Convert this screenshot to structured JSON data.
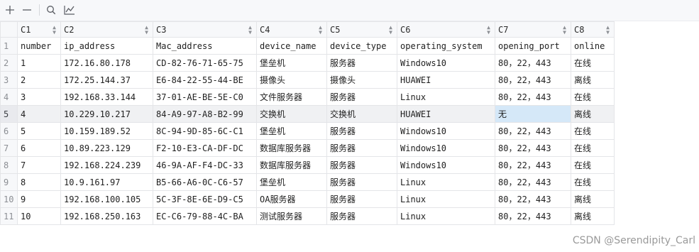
{
  "toolbar": {
    "add_icon": "plus-icon",
    "remove_icon": "minus-icon",
    "search_icon": "search-icon",
    "chart_icon": "line-chart-icon"
  },
  "columns": [
    "C1",
    "C2",
    "C3",
    "C4",
    "C5",
    "C6",
    "C7",
    "C8"
  ],
  "rows": [
    {
      "n": "1",
      "cells": [
        "number",
        "ip_address",
        "Mac_address",
        "device_name",
        "device_type",
        "operating_system",
        "opening_port",
        "online"
      ]
    },
    {
      "n": "2",
      "cells": [
        "1",
        "172.16.80.178",
        "CD-82-76-71-65-75",
        "堡垒机",
        "服务器",
        "Windows10",
        "80，22，443",
        "在线"
      ]
    },
    {
      "n": "3",
      "cells": [
        "2",
        "172.25.144.37",
        "E6-84-22-55-44-BE",
        "摄像头",
        "摄像头",
        "HUAWEI",
        "80，22，443",
        "离线"
      ]
    },
    {
      "n": "4",
      "cells": [
        "3",
        "192.168.33.144",
        "37-01-AE-BE-5E-C0",
        "文件服务器",
        "服务器",
        "Linux",
        "80，22，443",
        "在线"
      ]
    },
    {
      "n": "5",
      "cells": [
        "4",
        "10.229.10.217",
        "84-A9-97-A8-B2-99",
        "交换机",
        "交换机",
        "HUAWEI",
        "无",
        "离线"
      ]
    },
    {
      "n": "6",
      "cells": [
        "5",
        "10.159.189.52",
        "8C-94-9D-85-6C-C1",
        "堡垒机",
        "服务器",
        "Windows10",
        "80，22，443",
        "在线"
      ]
    },
    {
      "n": "7",
      "cells": [
        "6",
        "10.89.223.129",
        "F2-10-E3-CA-DF-DC",
        "数据库服务器",
        "服务器",
        "Windows10",
        "80，22，443",
        "在线"
      ]
    },
    {
      "n": "8",
      "cells": [
        "7",
        "192.168.224.239",
        "46-9A-AF-F4-DC-33",
        "数据库服务器",
        "服务器",
        "Windows10",
        "80，22，443",
        "在线"
      ]
    },
    {
      "n": "9",
      "cells": [
        "8",
        "10.9.161.97",
        "B5-66-A6-0C-C6-57",
        "堡垒机",
        "服务器",
        "Linux",
        "80，22，443",
        "在线"
      ]
    },
    {
      "n": "10",
      "cells": [
        "9",
        "192.168.100.105",
        "5C-3F-8E-6E-D9-C5",
        "OA服务器",
        "服务器",
        "Linux",
        "80，22，443",
        "离线"
      ]
    },
    {
      "n": "11",
      "cells": [
        "10",
        "192.168.250.163",
        "EC-C6-79-88-4C-BA",
        "测试服务器",
        "服务器",
        "Linux",
        "80，22，443",
        "离线"
      ]
    }
  ],
  "selected_row_index": 4,
  "current_cell_column": 6,
  "watermark": "CSDN @Serendipity_Carl",
  "colors": {
    "selected_row": "#f0f1f3",
    "current_cell": "#d5e8f8",
    "header_bg": "#f7f8fa",
    "grid_line": "#e4e5e8"
  }
}
